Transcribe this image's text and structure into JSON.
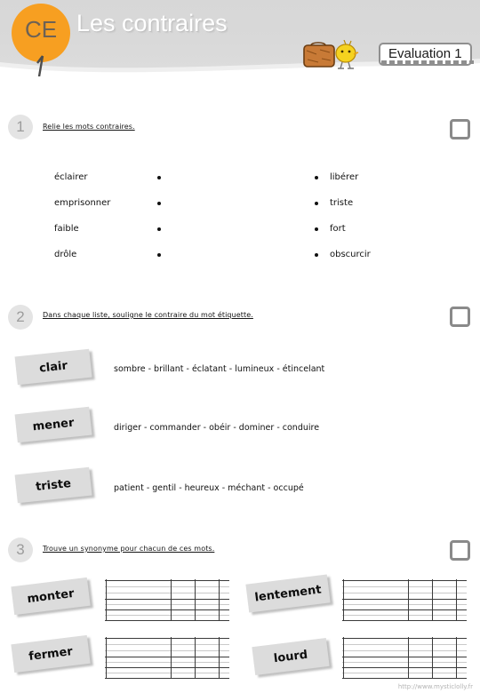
{
  "header": {
    "level": "CE",
    "level_sub": "1",
    "title": "Les contraires",
    "evaluation_label": "Evaluation 1",
    "mascot_icon": "briefcase-and-chick-icon"
  },
  "exercises": [
    {
      "number": "1",
      "instruction": "Relie les mots contraires.",
      "left_words": [
        "éclairer",
        "emprisonner",
        "faible",
        "drôle"
      ],
      "right_words": [
        "libérer",
        "triste",
        "fort",
        "obscurcir"
      ]
    },
    {
      "number": "2",
      "instruction": "Dans chaque liste, souligne le contraire du mot étiquette.",
      "rows": [
        {
          "tag": "clair",
          "words": "sombre - brillant - éclatant - lumineux - étincelant"
        },
        {
          "tag": "mener",
          "words": "diriger - commander - obéir - dominer - conduire"
        },
        {
          "tag": "triste",
          "words": "patient - gentil - heureux - méchant - occupé"
        }
      ]
    },
    {
      "number": "3",
      "instruction": "Trouve un synonyme pour chacun de ces mots.",
      "tags": [
        "monter",
        "lentement",
        "fermer",
        "lourd"
      ]
    }
  ],
  "footer": {
    "url": "http://www.mysticlolly.fr"
  },
  "colors": {
    "accent_orange": "#f79f21",
    "header_gray": "#d9d9d9",
    "tag_gray": "#dcdcdc",
    "number_circle": "#e4e4e4"
  }
}
